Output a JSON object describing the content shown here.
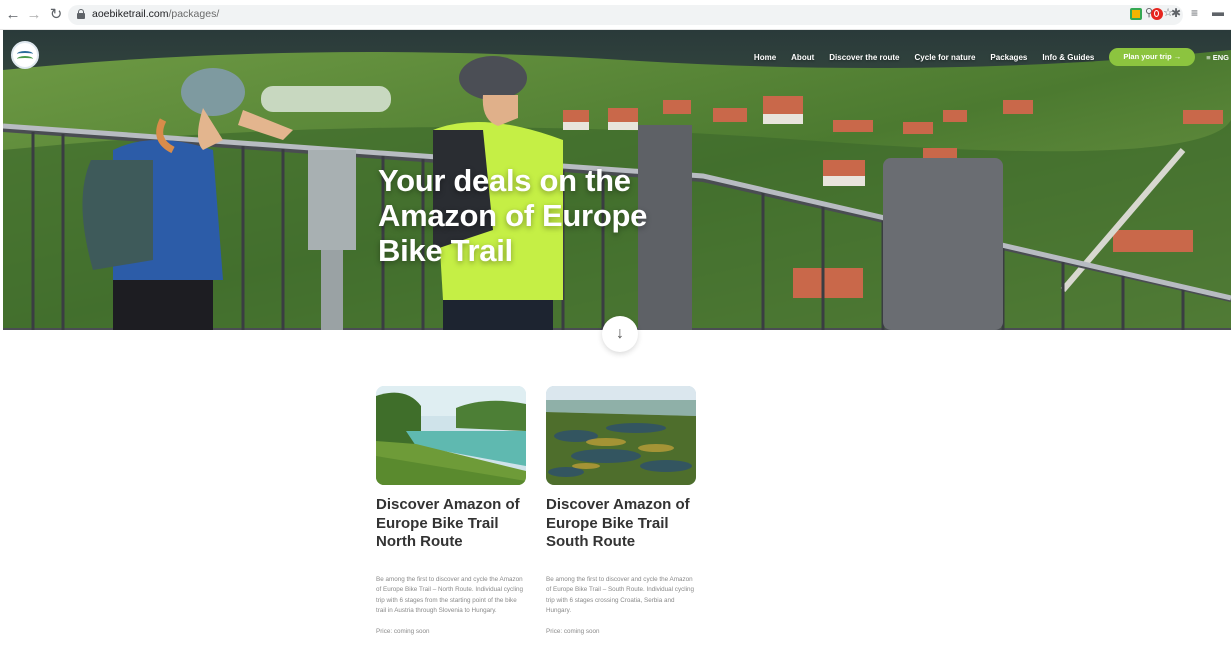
{
  "browser": {
    "url_host": "aoebiketrail.com",
    "url_path": "/packages/"
  },
  "header": {
    "menu": [
      "Home",
      "About",
      "Discover the route",
      "Cycle for nature",
      "Packages",
      "Info & Guides"
    ],
    "cta_label": "Plan your trip →",
    "language": "≡ ENG"
  },
  "hero": {
    "title": "Your deals on the Amazon of Europe Bike Trail",
    "scroll_icon": "↓"
  },
  "packages": [
    {
      "title": "Discover Amazon of Europe Bike Trail North Route",
      "description": "Be among the first to discover and cycle the Amazon of Europe Bike Trail – North Route. Individual cycling trip with 6 stages from the starting point of the bike trail in Austria through Slovenia to Hungary.",
      "price": "Price: coming soon"
    },
    {
      "title": "Discover Amazon of Europe Bike Trail South Route",
      "description": "Be among the first to discover and cycle the Amazon of Europe Bike Trail – South Route. Individual cycling trip with 6 stages crossing Croatia, Serbia and Hungary.",
      "price": "Price: coming soon"
    }
  ],
  "colors": {
    "accent": "#8cc43f",
    "heading": "#333333",
    "body_text": "#8a8a8a"
  },
  "icons": [
    "back-icon",
    "forward-icon",
    "reload-icon",
    "lock-icon",
    "zoom-icon",
    "star-icon",
    "logo-icon",
    "arrow-down-icon"
  ]
}
